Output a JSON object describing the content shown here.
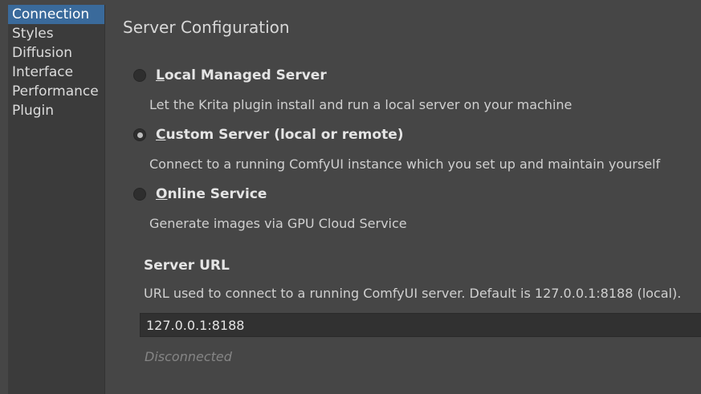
{
  "sidebar": {
    "items": [
      {
        "label": "Connection",
        "active": true
      },
      {
        "label": "Styles"
      },
      {
        "label": "Diffusion"
      },
      {
        "label": "Interface"
      },
      {
        "label": "Performance"
      },
      {
        "label": "Plugin"
      }
    ]
  },
  "main": {
    "title": "Server Configuration",
    "options": [
      {
        "mnemonic": "L",
        "label_rest": "ocal Managed Server",
        "description": "Let the Krita plugin install and run a local server on your machine",
        "checked": false
      },
      {
        "mnemonic": "C",
        "label_rest": "ustom Server (local or remote)",
        "description": "Connect to a running ComfyUI instance which you set up and maintain yourself",
        "checked": true
      },
      {
        "mnemonic": "O",
        "label_rest": "nline Service",
        "description": "Generate images via GPU Cloud Service",
        "checked": false
      }
    ],
    "server_url": {
      "label": "Server URL",
      "description": "URL used to connect to a running ComfyUI server. Default is 127.0.0.1:8188 (local).",
      "value": "127.0.0.1:8188"
    },
    "status": "Disconnected"
  }
}
